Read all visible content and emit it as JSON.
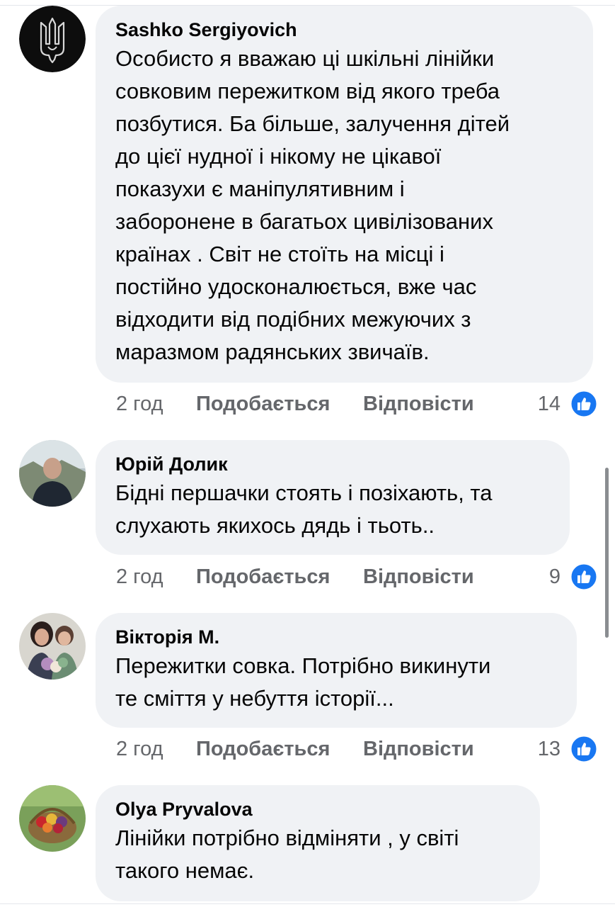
{
  "comments": [
    {
      "author": "Sashko Sergiyovich",
      "text": "Особисто я вважаю ці шкільні лінійки\nсовковим пережитком від якого треба\nпозбутися.  Ба більше, залучення дітей\nдо цієї нудної і нікому не цікавої\nпоказухи є маніпулятивним і\nзаборонене в багатьох цивілізованих\nкраїнах . Світ не стоїть на місці і\nпостійно удосконалюється, вже час\nвідходити від подібних межуючих з\nмаразмом радянських звичаїв.",
      "time": "2 год",
      "like_label": "Подобається",
      "reply_label": "Відповісти",
      "reactions": "14"
    },
    {
      "author": "Юрій Долик",
      "text": "Бідні першачки стоять і позіхають, та\nслухають якихось дядь і тьоть..",
      "time": "2 год",
      "like_label": "Подобається",
      "reply_label": "Відповісти",
      "reactions": "9"
    },
    {
      "author": "Вікторія М.",
      "text": "Пережитки совка. Потрібно викинути\nте сміття у небуття історії...",
      "time": "2 год",
      "like_label": "Подобається",
      "reply_label": "Відповісти",
      "reactions": "13"
    },
    {
      "author": "Olya Pryvalova",
      "text": "Лінійки потрібно відміняти , у світі\nтакого немає."
    }
  ],
  "icons": {
    "like_badge": "like-thumb-icon"
  },
  "colors": {
    "bubble": "#f0f2f5",
    "secondary_text": "#65676b",
    "like_blue": "#1877f2"
  }
}
